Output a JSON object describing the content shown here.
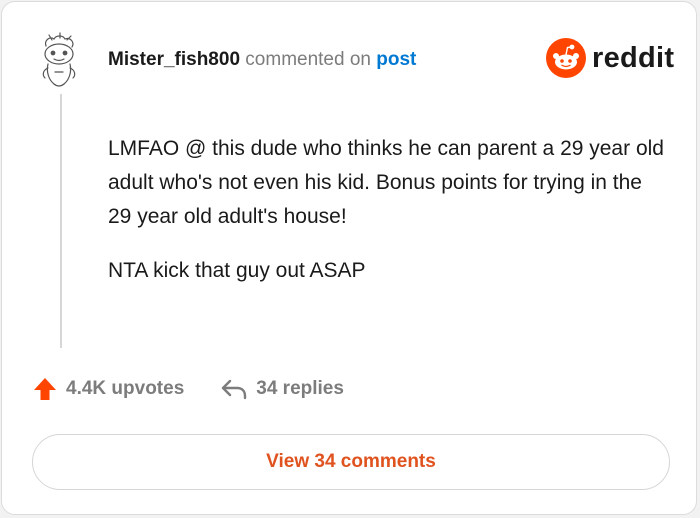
{
  "comment": {
    "author": "Mister_fish800",
    "action_text": "commented on",
    "post_link_label": "post",
    "paragraphs": [
      "LMFAO @ this dude who thinks he can parent a 29 year old adult who's not even his kid. Bonus points for trying in the 29 year old adult's house!",
      "NTA kick that guy out ASAP"
    ]
  },
  "brand": {
    "name": "reddit",
    "icon": "reddit-logo-icon",
    "color": "#ff4500"
  },
  "stats": {
    "upvotes_label": "4.4K upvotes",
    "replies_label": "34 replies",
    "upvote_icon": "upvote-arrow-icon",
    "reply_icon": "reply-arrow-icon"
  },
  "footer": {
    "view_button_label": "View 34 comments"
  },
  "colors": {
    "accent": "#ff4500",
    "link": "#0079d3",
    "muted": "#7c7c7c",
    "view_button_text": "#e0531f"
  }
}
